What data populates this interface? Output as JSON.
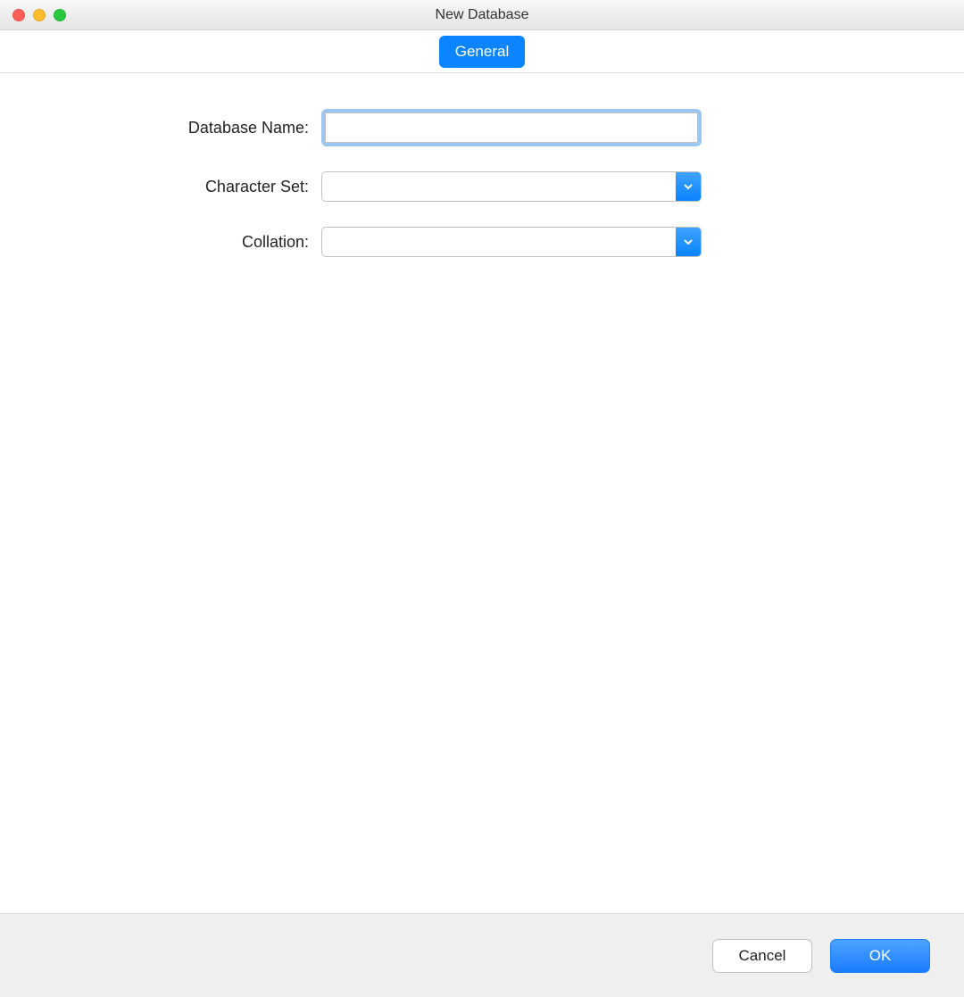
{
  "window": {
    "title": "New Database"
  },
  "tabs": {
    "general": "General"
  },
  "form": {
    "database_name": {
      "label": "Database Name:",
      "value": ""
    },
    "character_set": {
      "label": "Character Set:",
      "value": ""
    },
    "collation": {
      "label": "Collation:",
      "value": ""
    }
  },
  "footer": {
    "cancel": "Cancel",
    "ok": "OK"
  }
}
